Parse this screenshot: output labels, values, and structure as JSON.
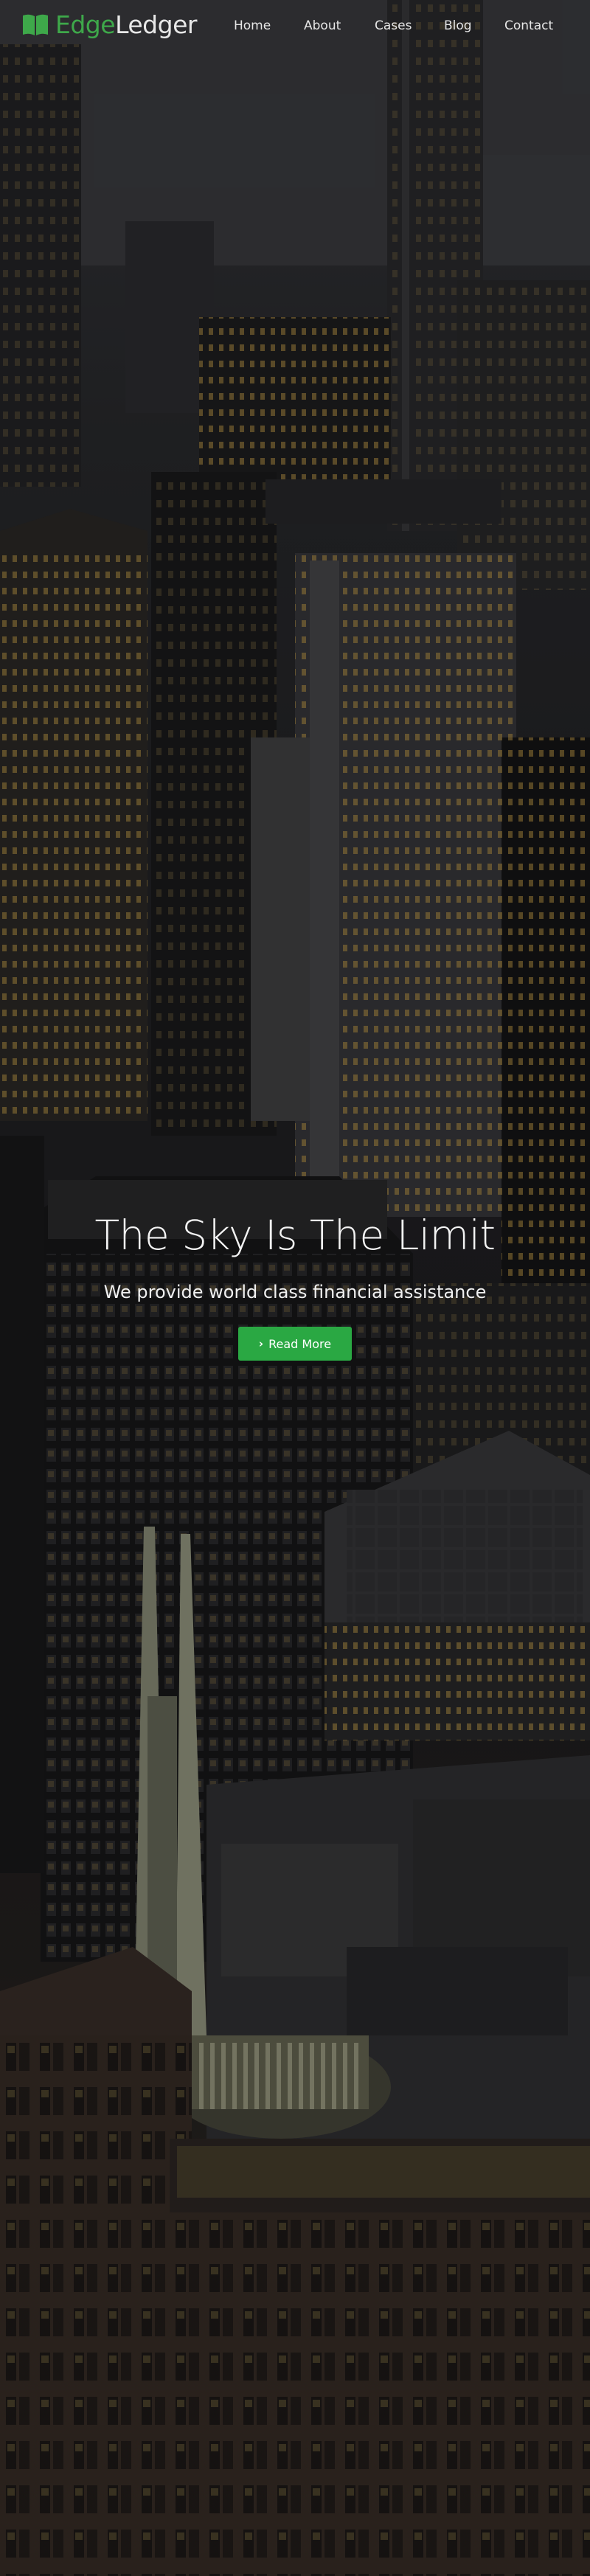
{
  "brand": {
    "name_part1": "Edge",
    "name_part2": "Ledger",
    "icon": "open-book-icon",
    "accent_color": "#3ea84a"
  },
  "nav": {
    "items": [
      {
        "label": "Home"
      },
      {
        "label": "About"
      },
      {
        "label": "Cases"
      },
      {
        "label": "Blog"
      },
      {
        "label": "Contact"
      }
    ]
  },
  "hero": {
    "title": "The Sky Is The Limit",
    "subtitle": "We provide world class financial assistance",
    "cta_label": "Read More",
    "cta_icon": "chevron-right-icon",
    "cta_color": "#2aa843",
    "background": "night-city-skyline-photo"
  }
}
